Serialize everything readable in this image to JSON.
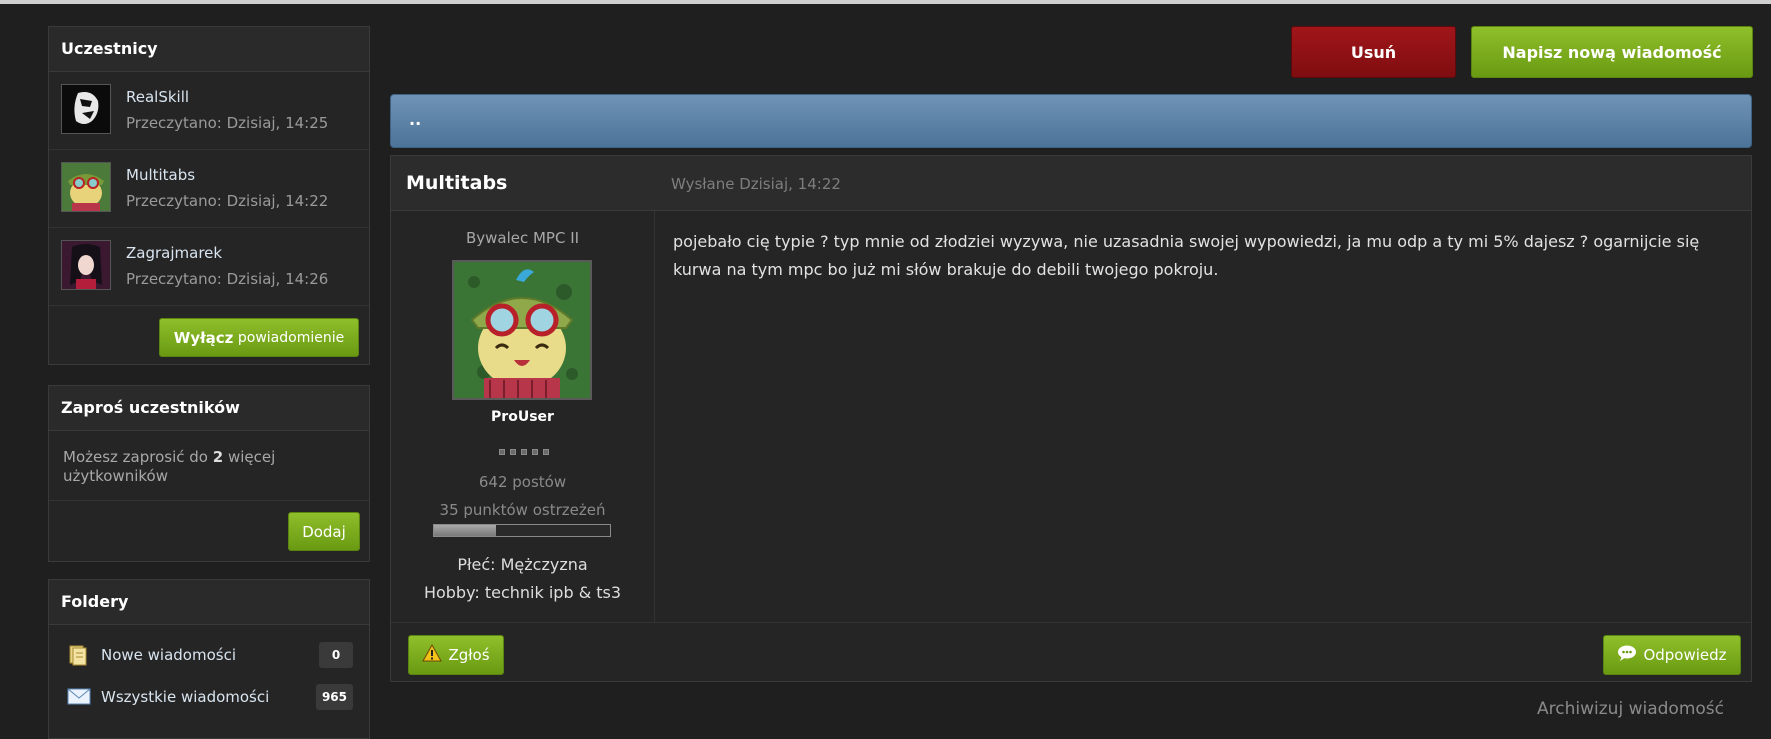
{
  "participants_box": {
    "title": "Uczestnicy",
    "items": [
      {
        "name": "RealSkill",
        "read": "Przeczytano: Dzisiaj, 14:25"
      },
      {
        "name": "Multitabs",
        "read": "Przeczytano: Dzisiaj, 14:22"
      },
      {
        "name": "Zagrajmarek",
        "read": "Przeczytano: Dzisiaj, 14:26"
      }
    ],
    "disable_bold": "Wyłącz",
    "disable_rest": " powiadomienie"
  },
  "invite_box": {
    "title": "Zaproś uczestników",
    "text_before": "Możesz zaprosić do ",
    "count": "2",
    "text_after": " więcej użytkowników",
    "add_label": "Dodaj"
  },
  "folders_box": {
    "title": "Foldery",
    "items": [
      {
        "label": "Nowe wiadomości",
        "count": "0"
      },
      {
        "label": "Wszystkie wiadomości",
        "count": "965"
      }
    ]
  },
  "toolbar": {
    "delete_label": "Usuń",
    "new_message_label": "Napisz nową wiadomość"
  },
  "conversation": {
    "title": ".."
  },
  "post": {
    "author": "Multitabs",
    "date": "Wysłane Dzisiaj, 14:22",
    "rank": "Bywalec MPC II",
    "group": "ProUser",
    "posts": "642 postów",
    "warnings": "35 punktów ostrzeżeń",
    "warning_level": 0.35,
    "gender": "Płeć: Mężczyzna",
    "hobby": "Hobby: technik ipb & ts3",
    "body": "pojebało cię typie ? typ mnie od złodziei wyzywa, nie uzasadnia swojej wypowiedzi, ja mu odp a ty mi 5% dajesz ? ogarnijcie się kurwa na tym mpc bo już mi słów brakuje do debili twojego pokroju.",
    "report_label": "Zgłoś",
    "reply_label": "Odpowiedz"
  },
  "archive_label": "Archiwizuj wiadomość",
  "colors": {
    "green": "#7bab1c",
    "red": "#8e1114",
    "blue_bar": "#5b82a8",
    "link": "#d8e4ef"
  },
  "icons": {
    "folder_new": "folder-docs-icon",
    "folder_all": "envelope-icon",
    "report": "warning-icon",
    "reply": "speech-bubble-icon",
    "rating": "rating-pips"
  }
}
